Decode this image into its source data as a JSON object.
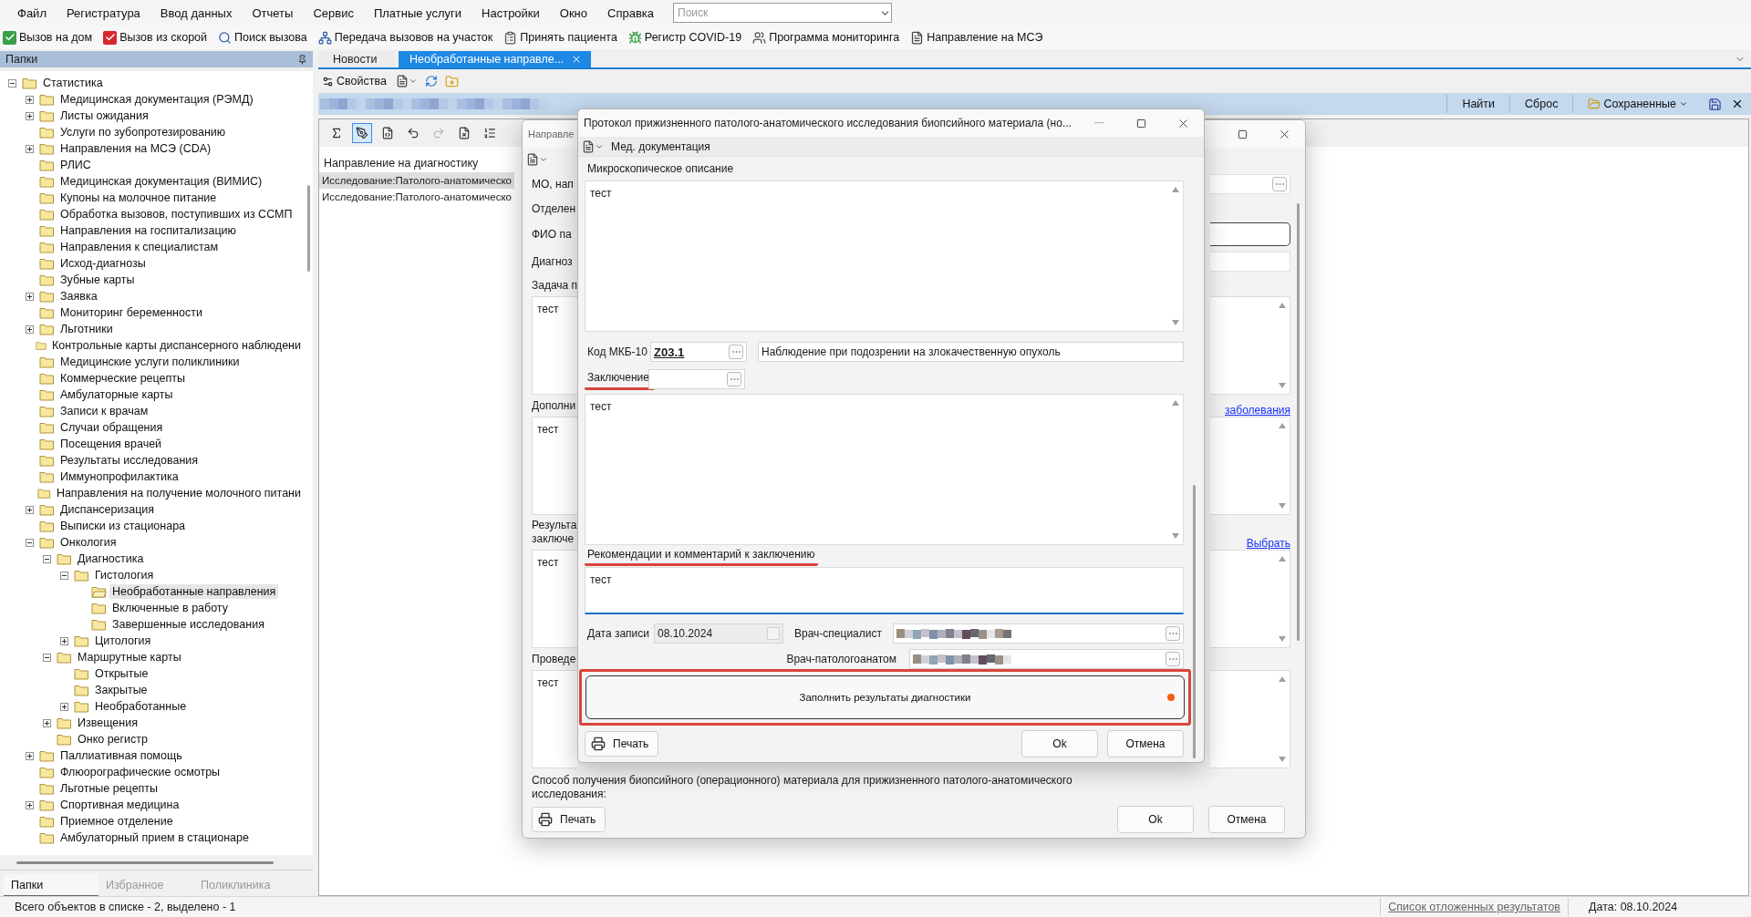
{
  "menu": {
    "items": [
      "Файл",
      "Регистратура",
      "Ввод данных",
      "Отчеты",
      "Сервис",
      "Платные услуги",
      "Настройки",
      "Окно",
      "Справка"
    ],
    "search": {
      "placeholder": "Поиск"
    }
  },
  "toolbar": [
    {
      "kind": "home",
      "label": "Вызов на дом"
    },
    {
      "kind": "ambulance",
      "label": "Вызов из скорой"
    },
    {
      "kind": "search",
      "label": "Поиск вызова"
    },
    {
      "kind": "transfer",
      "label": "Передача вызовов на участок"
    },
    {
      "kind": "patient",
      "label": "Принять пациента"
    },
    {
      "kind": "covid",
      "label": "Регистр COVID-19"
    },
    {
      "kind": "monitoring",
      "label": "Программа мониторинга"
    },
    {
      "kind": "mse",
      "label": "Направление на МСЭ"
    }
  ],
  "folders_panel": {
    "title": "Папки",
    "tree": [
      {
        "label": "Статистика",
        "expanded": true,
        "selected": false,
        "children": [
          {
            "label": "Медицинская документация (РЭМД)",
            "expanded": false,
            "selected": false
          },
          {
            "label": "Листы ожидания",
            "expanded": false,
            "selected": false
          },
          {
            "label": "Услуги по зубопротезированию",
            "selected": false
          },
          {
            "label": "Направления на МСЭ (CDA)",
            "expanded": false,
            "selected": false
          },
          {
            "label": "РЛИС",
            "selected": false
          },
          {
            "label": "Медицинская документация (ВИМИС)",
            "selected": false
          },
          {
            "label": "Купоны на молочное питание",
            "selected": false
          },
          {
            "label": "Обработка вызовов, поступивших из ССМП",
            "selected": false
          },
          {
            "label": "Направления на госпитализацию",
            "selected": false
          },
          {
            "label": "Направления к специалистам",
            "selected": false
          },
          {
            "label": "Исход-диагнозы",
            "selected": false
          },
          {
            "label": "Зубные карты",
            "selected": false
          },
          {
            "label": "Заявка",
            "expanded": false,
            "selected": false
          },
          {
            "label": "Мониторинг беременности",
            "selected": false
          },
          {
            "label": "Льготники",
            "expanded": false,
            "selected": false
          },
          {
            "label": "Контрольные карты диспансерного наблюдени",
            "selected": false
          },
          {
            "label": "Медицинские услуги поликлиники",
            "selected": false
          },
          {
            "label": "Коммерческие рецепты",
            "selected": false
          },
          {
            "label": "Амбулаторные карты",
            "selected": false
          },
          {
            "label": "Записи к врачам",
            "selected": false
          },
          {
            "label": "Случаи обращения",
            "selected": false
          },
          {
            "label": "Посещения врачей",
            "selected": false
          },
          {
            "label": "Результаты исследования",
            "selected": false
          },
          {
            "label": "Иммунопрофилактика",
            "selected": false
          },
          {
            "label": "Направления на получение молочного питани",
            "selected": false
          },
          {
            "label": "Диспансеризация",
            "expanded": false,
            "selected": false
          },
          {
            "label": "Выписки из стационара",
            "selected": false
          },
          {
            "label": "Онкология",
            "expanded": true,
            "selected": false,
            "children": [
              {
                "label": "Диагностика",
                "expanded": true,
                "selected": false,
                "children": [
                  {
                    "label": "Гистология",
                    "expanded": true,
                    "selected": false,
                    "children": [
                      {
                        "label": "Необработанные направления",
                        "selected": true
                      },
                      {
                        "label": "Включенные в работу",
                        "selected": false
                      },
                      {
                        "label": "Завершенные исследования",
                        "selected": false
                      }
                    ]
                  },
                  {
                    "label": "Цитология",
                    "expanded": false,
                    "selected": false
                  }
                ]
              },
              {
                "label": "Маршрутные карты",
                "expanded": true,
                "selected": false,
                "children": [
                  {
                    "label": "Открытые",
                    "selected": false
                  },
                  {
                    "label": "Закрытые",
                    "selected": false
                  },
                  {
                    "label": "Необработанные",
                    "expanded": false,
                    "selected": false
                  }
                ]
              },
              {
                "label": "Извещения",
                "expanded": false,
                "selected": false
              },
              {
                "label": "Онко регистр",
                "selected": false
              }
            ]
          },
          {
            "label": "Паллиативная помощь",
            "expanded": false,
            "selected": false
          },
          {
            "label": "Флюорографические осмотры",
            "selected": false
          },
          {
            "label": "Льготные рецепты",
            "selected": false
          },
          {
            "label": "Спортивная медицина",
            "expanded": false,
            "selected": false
          },
          {
            "label": "Приемное отделение",
            "selected": false
          },
          {
            "label": "Амбулаторный прием в стационаре",
            "selected": false
          }
        ]
      }
    ],
    "tabs": [
      {
        "label": "Папки",
        "selected": true
      },
      {
        "label": "Избранное",
        "selected": false
      },
      {
        "label": "Поликлиника",
        "selected": false
      }
    ]
  },
  "document_tabs": [
    {
      "label": "Новости",
      "selected": false
    },
    {
      "label": "Необработанные направле...",
      "selected": true
    }
  ],
  "view_toolbar": {
    "properties": "Свойства"
  },
  "filter_bar": {
    "find": "Найти",
    "reset": "Сброс",
    "saved": "Сохраненные"
  },
  "list_toolbar": [
    {
      "kind": "formula",
      "pressed": false,
      "disabled": false
    },
    {
      "kind": "markup",
      "pressed": true,
      "disabled": false
    },
    {
      "kind": "xml",
      "pressed": false,
      "disabled": false
    },
    {
      "kind": "undo",
      "pressed": false,
      "disabled": false
    },
    {
      "kind": "redo",
      "pressed": false,
      "disabled": true
    },
    {
      "kind": "delete",
      "pressed": false,
      "disabled": false
    },
    {
      "kind": "list",
      "pressed": false,
      "disabled": false
    }
  ],
  "list": {
    "header": "Направление на диагностику",
    "rows": [
      {
        "text": "Исследование:Патолого-анатомическо",
        "selected": true
      },
      {
        "text": "Исследование:Патолого-анатомическо",
        "selected": false
      }
    ]
  },
  "referral_dialog": {
    "title": "Направле",
    "rows": [
      {
        "kind": "picker-field",
        "label": "МО, нап"
      },
      {
        "kind": "label",
        "label": "Отделен"
      },
      {
        "kind": "field",
        "label": "ФИО па",
        "focused": true
      },
      {
        "kind": "field",
        "label": "Диагноз",
        "focused": false
      },
      {
        "kind": "label",
        "label": "Задача п"
      },
      {
        "kind": "textarea",
        "value": "тест"
      },
      {
        "kind": "label",
        "label": "Дополни",
        "link": "заболевания"
      },
      {
        "kind": "textarea",
        "value": "тест"
      },
      {
        "kind": "label",
        "label": "Результа\nзаключе",
        "link": "Выбрать"
      },
      {
        "kind": "textarea",
        "value": "тест"
      },
      {
        "kind": "label",
        "label": "Проведе"
      },
      {
        "kind": "textarea",
        "value": "тест"
      }
    ],
    "method_text": "Способ получения биопсийного (операционного) материала для прижизненного патолого-анатомического исследования:",
    "buttons": {
      "print": "Печать",
      "ok": "Ok",
      "cancel": "Отмена"
    }
  },
  "protocol_dialog": {
    "title": "Протокол прижизненного патолого-анатомического исследования биопсийного материала (но...",
    "toolbar_label": "Мед. документация",
    "microscopic": {
      "label": "Микроскопическое описание",
      "value": "тест"
    },
    "icd": {
      "label": "Код МКБ-10",
      "code": "Z03.1",
      "description": "Наблюдение при подозрении на злокачественную опухоль"
    },
    "conclusion": {
      "label": "Заключение",
      "highlighted": true,
      "value": "тест"
    },
    "recommendations": {
      "label": "Рекомендации и комментарий к заключению",
      "highlighted": true,
      "value": "тест",
      "focused": true
    },
    "record_date": {
      "label": "Дата записи",
      "value": "08.10.2024",
      "disabled": true
    },
    "specialist": {
      "label": "Врач-специалист"
    },
    "pathologist": {
      "label": "Врач-патологоанатом"
    },
    "fill_button": {
      "label": "Заполнить результаты диагностики",
      "highlighted": true,
      "attention": true
    },
    "buttons": {
      "print": "Печать",
      "ok": "Ok",
      "cancel": "Отмена"
    }
  },
  "status_bar": {
    "summary": "Всего объектов в списке - 2, выделено - 1",
    "deferred_link": "Список отложенных результатов",
    "date": "Дата: 08.10.2024"
  }
}
